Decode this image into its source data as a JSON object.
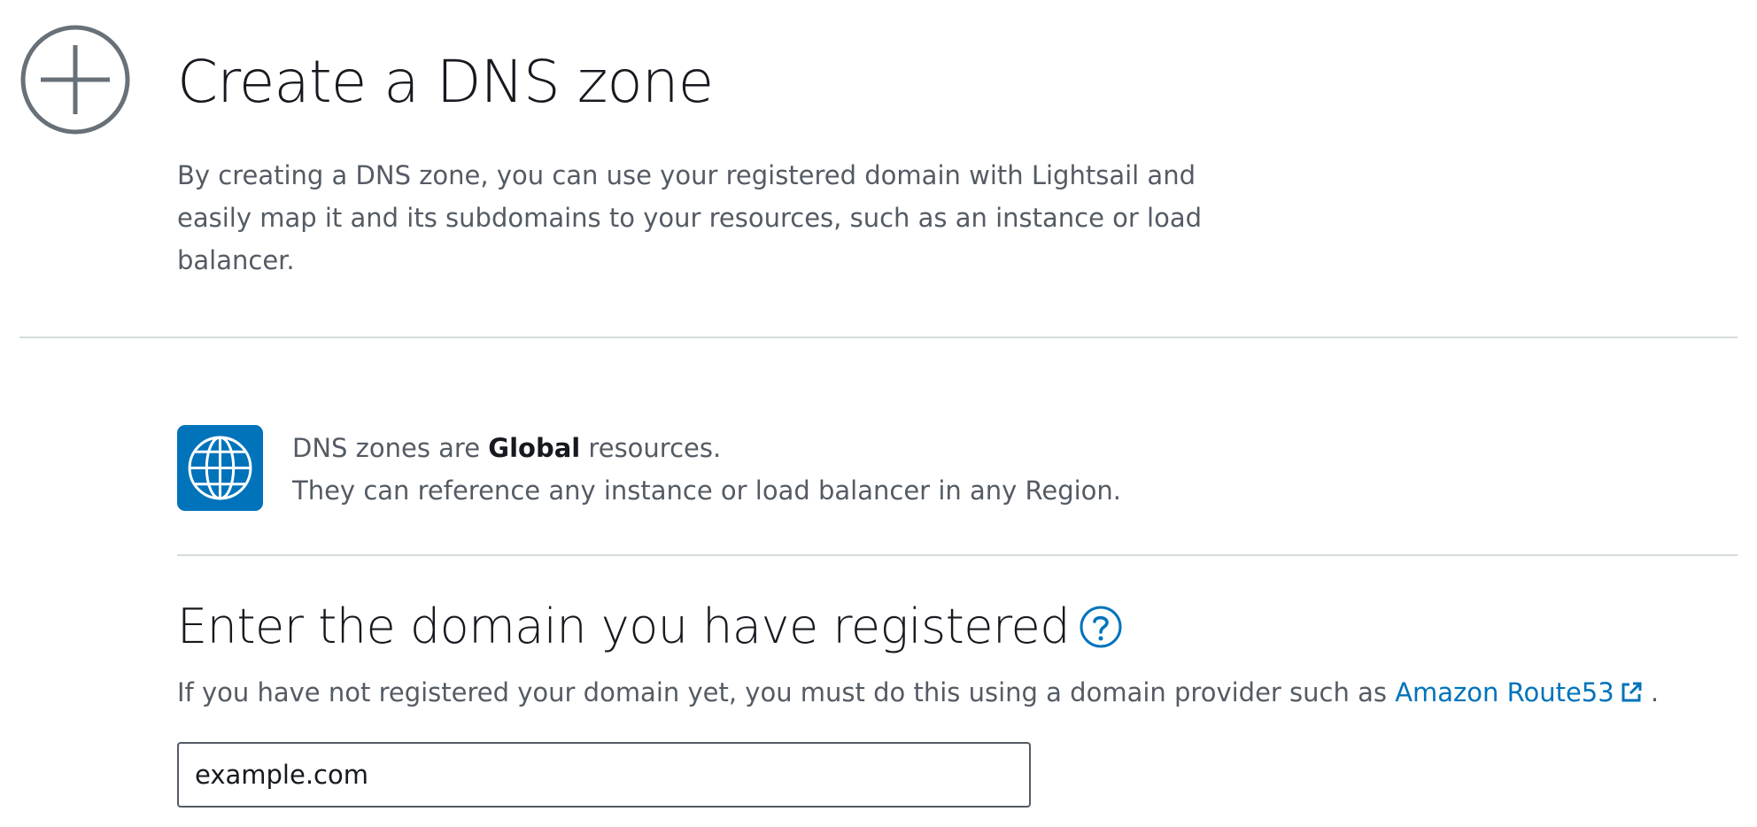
{
  "header": {
    "icon": "plus-circle-icon",
    "title": "Create a DNS zone",
    "description": "By creating a DNS zone, you can use your registered domain with Lightsail and easily map it and its subdomains to your resources, such as an instance or load balancer."
  },
  "global_notice": {
    "icon": "globe-icon",
    "line1_prefix": "DNS zones are ",
    "line1_bold": "Global",
    "line1_suffix": " resources.",
    "line2": "They can reference any instance or load balancer in any Region."
  },
  "domain_section": {
    "title": "Enter the domain you have registered",
    "help_icon": "help-icon",
    "description_prefix": "If you have not registered your domain yet, you must do this using a domain provider such as ",
    "link_label": "Amazon Route53",
    "link_icon": "external-link-icon",
    "description_suffix": " .",
    "input_value": "example.com"
  },
  "colors": {
    "accent": "#0073bb",
    "text_primary": "#16191f",
    "text_secondary": "#545b64",
    "divider": "#d5dbdb"
  }
}
